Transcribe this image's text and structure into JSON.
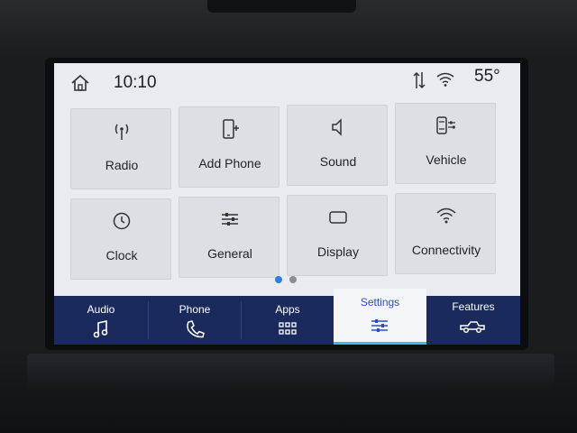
{
  "status": {
    "time": "10:10",
    "temperature": "55°",
    "icons": [
      "home-icon",
      "data-transfer-icon",
      "wifi-icon"
    ]
  },
  "tiles": [
    {
      "label": "Radio",
      "icon": "radio-antenna-icon"
    },
    {
      "label": "Add Phone",
      "icon": "add-phone-icon"
    },
    {
      "label": "Sound",
      "icon": "speaker-icon"
    },
    {
      "label": "Vehicle",
      "icon": "vehicle-settings-icon"
    },
    {
      "label": "Clock",
      "icon": "clock-icon"
    },
    {
      "label": "General",
      "icon": "sliders-icon"
    },
    {
      "label": "Display",
      "icon": "display-icon"
    },
    {
      "label": "Connectivity",
      "icon": "wifi-icon"
    }
  ],
  "pager": {
    "total": 2,
    "current": 1,
    "active_color": "#2f7fe0",
    "inactive_color": "#8a8f96"
  },
  "tabbar": {
    "tabs": [
      {
        "label": "Audio",
        "icon": "music-note-icon"
      },
      {
        "label": "Phone",
        "icon": "phone-handset-icon"
      },
      {
        "label": "Apps",
        "icon": "apps-grid-icon"
      },
      {
        "label": "Settings",
        "icon": "settings-sliders-icon",
        "active": true
      },
      {
        "label": "Features",
        "icon": "truck-icon"
      }
    ],
    "background": "#1b2a5c",
    "accent": "#46b6e8"
  }
}
